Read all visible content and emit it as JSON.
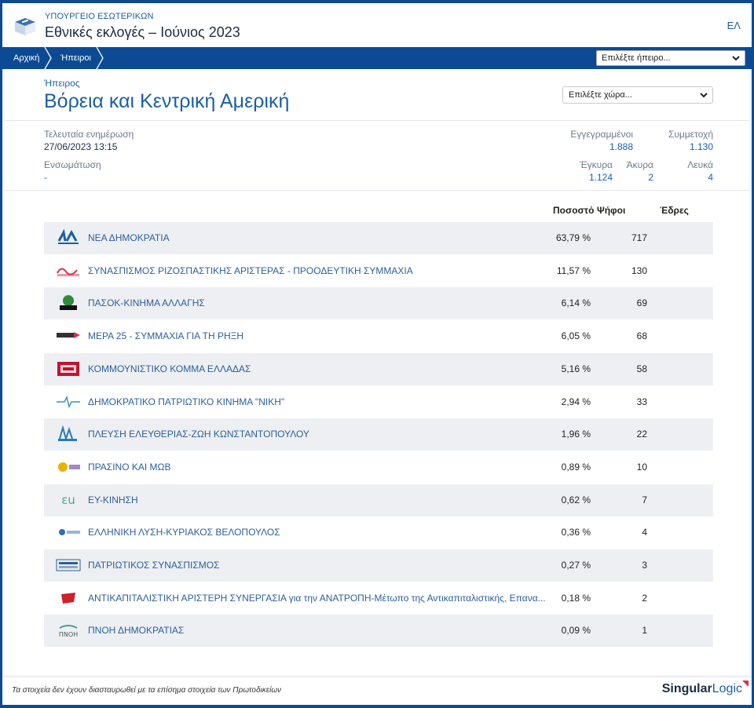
{
  "header": {
    "ministry": "ΥΠΟΥΡΓΕΙΟ ΕΣΩΤΕΡΙΚΩΝ",
    "title": "Εθνικές εκλογές – Ιούνιος 2023",
    "language": "ΕΛ"
  },
  "breadcrumb": {
    "home": "Αρχική",
    "continents": "Ήπειροι"
  },
  "nav": {
    "continent_select": "Επιλέξτε ήπειρο..."
  },
  "region": {
    "label": "Ήπειρος",
    "title": "Βόρεια και Κεντρική Αμερική",
    "country_select": "Επιλέξτε χώρα..."
  },
  "meta": {
    "last_update_label": "Τελευταία ενημέρωση",
    "last_update_value": "27/06/2023 13:15",
    "integration_label": "Ενσωμάτωση",
    "integration_value": "-"
  },
  "stats": {
    "registered_label": "Εγγεγραμμένοι",
    "registered_value": "1.888",
    "turnout_label": "Συμμετοχή",
    "turnout_value": "1.130",
    "valid_label": "Έγκυρα",
    "valid_value": "1.124",
    "invalid_label": "Άκυρα",
    "invalid_value": "2",
    "blank_label": "Λευκά",
    "blank_value": "4"
  },
  "table": {
    "col_percent": "Ποσοστό",
    "col_votes": "Ψήφοι",
    "col_seats": "Έδρες",
    "rows": [
      {
        "name": "ΝΕΑ ΔΗΜΟΚΡΑΤΙΑ",
        "pct": "63,79 %",
        "votes": "717",
        "logo": "nd-logo",
        "color": "#1a5fa8"
      },
      {
        "name": "ΣΥΝΑΣΠΙΣΜΟΣ ΡΙΖΟΣΠΑΣΤΙΚΗΣ ΑΡΙΣΤΕΡΑΣ - ΠΡΟΟΔΕΥΤΙΚΗ ΣΥΜΜΑΧΙΑ",
        "pct": "11,57 %",
        "votes": "130",
        "logo": "syriza-logo",
        "color": "#d9304a"
      },
      {
        "name": "ΠΑΣΟΚ-ΚΙΝΗΜΑ ΑΛΛΑΓΗΣ",
        "pct": "6,14 %",
        "votes": "69",
        "logo": "pasok-logo",
        "color": "#2e8b3a"
      },
      {
        "name": "ΜΕΡΑ 25 - ΣΥΜΜΑΧΙΑ ΓΙΑ ΤΗ ΡΗΞΗ",
        "pct": "6,05 %",
        "votes": "68",
        "logo": "mera25-logo",
        "color": "#d9304a"
      },
      {
        "name": "ΚΟΜΜΟΥΝΙΣΤΙΚΟ ΚΟΜΜΑ ΕΛΛΑΔΑΣ",
        "pct": "5,16 %",
        "votes": "58",
        "logo": "kke-logo",
        "color": "#c8102e"
      },
      {
        "name": "ΔΗΜΟΚΡΑΤΙΚΟ ΠΑΤΡΙΩΤΙΚΟ ΚΙΝΗΜΑ \"ΝΙΚΗ\"",
        "pct": "2,94 %",
        "votes": "33",
        "logo": "niki-logo",
        "color": "#3a8fd0"
      },
      {
        "name": "ΠΛΕΥΣΗ ΕΛΕΥΘΕΡΙΑΣ-ΖΩΗ ΚΩΝΣΤΑΝΤΟΠΟΥΛΟΥ",
        "pct": "1,96 %",
        "votes": "22",
        "logo": "plefsi-logo",
        "color": "#2a7ab8"
      },
      {
        "name": "ΠΡΑΣΙΝΟ ΚΑΙ ΜΩΒ",
        "pct": "0,89 %",
        "votes": "10",
        "logo": "prasino-mov-logo",
        "color": "#e8b400"
      },
      {
        "name": "ΕΥ-ΚΙΝΗΣΗ",
        "pct": "0,62 %",
        "votes": "7",
        "logo": "ey-kinisi-logo",
        "color": "#3fae8a"
      },
      {
        "name": "ΕΛΛΗΝΙΚΗ ΛΥΣΗ-ΚΥΡΙΑΚΟΣ ΒΕΛΟΠΟΥΛΟΣ",
        "pct": "0,36 %",
        "votes": "4",
        "logo": "elliniki-lysi-logo",
        "color": "#2a6fb8"
      },
      {
        "name": "ΠΑΤΡΙΩΤΙΚΟΣ ΣΥΝΑΣΠΙΣΜΟΣ",
        "pct": "0,27 %",
        "votes": "3",
        "logo": "patriotikos-logo",
        "color": "#2a5f9e"
      },
      {
        "name": "ΑΝΤΙΚΑΠΙΤΑΛΙΣΤΙΚΗ ΑΡΙΣΤΕΡΗ ΣΥΝΕΡΓΑΣΙΑ για την ΑΝΑΤΡΟΠΗ-Μέτωπο της Αντικαπιταλιστικής, Επανα...",
        "pct": "0,18 %",
        "votes": "2",
        "logo": "antarsya-logo",
        "color": "#d0202a"
      },
      {
        "name": "ΠΝΟΗ ΔΗΜΟΚΡΑΤΙΑΣ",
        "pct": "0,09 %",
        "votes": "1",
        "logo": "pnoi-logo",
        "color": "#4a9a9a"
      }
    ]
  },
  "footer": {
    "note": "Τα στοιχεία δεν έχουν διασταυρωθεί με τα επίσημα στοιχεία των Πρωτοδικείων",
    "brand_a": "Singular",
    "brand_b": "Logic"
  },
  "colors": {
    "primary": "#0d4a94",
    "link": "#1a5fa8",
    "row_shade": "#edeff2"
  }
}
